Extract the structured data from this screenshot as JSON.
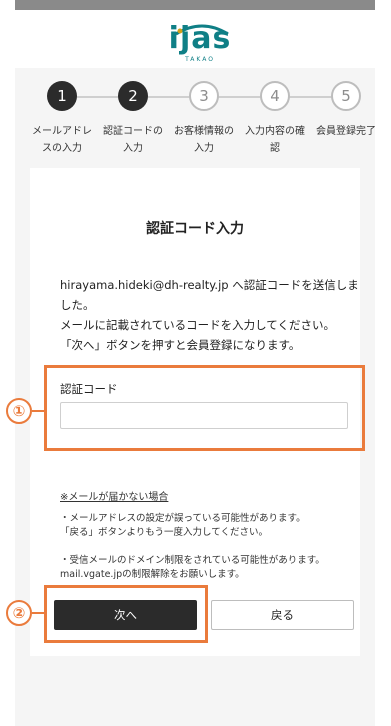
{
  "brand": {
    "logo_text": "ijas",
    "logo_sub": "TAKAO",
    "color": "#0f7f86"
  },
  "stepper": {
    "steps": [
      {
        "num": "1",
        "label": "メールアドレスの入力",
        "state": "done"
      },
      {
        "num": "2",
        "label": "認証コードの入力",
        "state": "done"
      },
      {
        "num": "3",
        "label": "お客様情報の入力",
        "state": "todo"
      },
      {
        "num": "4",
        "label": "入力内容の確認",
        "state": "todo"
      },
      {
        "num": "5",
        "label": "会員登録完了",
        "state": "todo"
      }
    ]
  },
  "form": {
    "title": "認証コード入力",
    "lead_line1": "hirayama.hideki@dh-realty.jp へ認証コードを送信しました。",
    "lead_line2": "メールに記載されているコードを入力してください。",
    "lead_line3": "「次へ」ボタンを押すと会員登録になります。",
    "code_label": "認証コード",
    "code_value": "",
    "code_placeholder": ""
  },
  "notes": {
    "title": "※メールが届かない場合",
    "item1_line1": "・メールアドレスの設定が誤っている可能性があります。",
    "item1_line2": "「戻る」ボタンよりもう一度入力してください。",
    "item2_line1": "・受信メールのドメイン制限をされている可能性があります。",
    "item2_line2": "mail.vgate.jpの制限解除をお願いします。"
  },
  "buttons": {
    "next": "次へ",
    "back": "戻る"
  },
  "annotations": {
    "marker1": "①",
    "marker2": "②",
    "color": "#ea7b3c"
  }
}
